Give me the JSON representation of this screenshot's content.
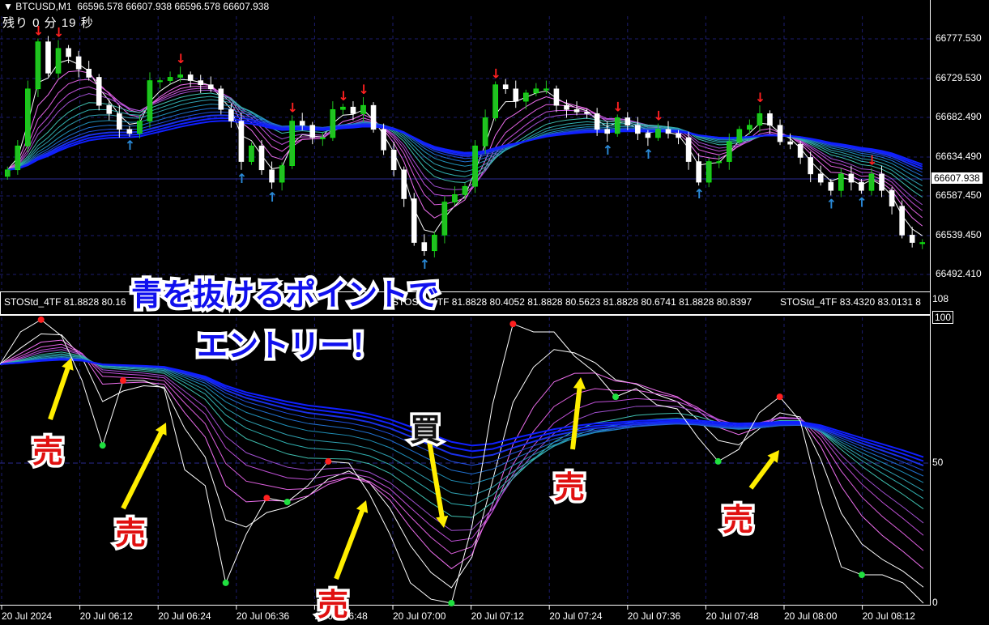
{
  "header": {
    "symbol": "▼ BTCUSD,M1",
    "ohlc": "66596.578 66607.938 66596.578 66607.938",
    "countdown": "残り 0 分 19 秒"
  },
  "indicator_legend": [
    "STOStd_4TF 81.8828 80.16",
    "STOStd_4TF 81.8828 80.4052 81.8828 80.5623 81.8828 80.6741 81.8828 80.8397",
    "STOStd_4TF 83.4320 83.0131 8"
  ],
  "colors": {
    "up": "#22c022",
    "down": "#ffffff",
    "grid": "#1c1c6e",
    "sell": "#ff2020",
    "buy": "#2a8ad8",
    "annotation_text": "#1010ee",
    "annotation_mark": "#e01010",
    "arrow": "#ffee00"
  },
  "chart_data": [
    {
      "type": "candlestick",
      "symbol": "BTCUSD",
      "timeframe": "M1",
      "price_ticks": [
        "66777.530",
        "66729.530",
        "66682.490",
        "66634.490",
        "66587.450",
        "66539.450",
        "66492.410"
      ],
      "current_price": "66607.938",
      "ylim": [
        66470,
        66805
      ],
      "closes": [
        66619,
        66648,
        66717,
        66774,
        66736,
        66766,
        66756,
        66741,
        66731,
        66697,
        66687,
        66668,
        66663,
        66678,
        66727,
        66727,
        66731,
        66734,
        66727,
        66722,
        66717,
        66692,
        66678,
        66629,
        66648,
        66619,
        66604,
        66624,
        66678,
        66673,
        66658,
        66658,
        66692,
        66695,
        66687,
        66697,
        66668,
        66643,
        66619,
        66584,
        66531,
        66521,
        66540,
        66580,
        66589,
        66599,
        66648,
        66682,
        66722,
        66717,
        66702,
        66712,
        66717,
        66717,
        66697,
        66692,
        66689,
        66687,
        66668,
        66663,
        66682,
        66673,
        66663,
        66658,
        66668,
        66663,
        66658,
        66629,
        66604,
        66629,
        66629,
        66653,
        66668,
        66673,
        66687,
        66673,
        66653,
        66650,
        66634,
        66614,
        66604,
        66594,
        66614,
        66604,
        66594,
        66614,
        66594,
        66575,
        66540,
        66531,
        66531
      ]
    },
    {
      "type": "line",
      "name": "STOStd_4TF",
      "y_ticks": [
        "108",
        "100",
        "50",
        "0"
      ],
      "ylim": [
        0,
        100
      ],
      "values": [
        83.6,
        94.9,
        99.2,
        93.5,
        77.9,
        55.2,
        77.9,
        77.9,
        75.1,
        46.7,
        41.1,
        7.1,
        24.1,
        36.8,
        35.4,
        41.1,
        49.6,
        49.0,
        38.2,
        24.1,
        7.1,
        1.4,
        0,
        26.9,
        69.4,
        97.7,
        94.9,
        94.9,
        86.4,
        80.7,
        72.2,
        75.1,
        69.4,
        68.0,
        58.1,
        49.6,
        53.8,
        66.6,
        72.2,
        63.7,
        35.4,
        12.7,
        9.9,
        9.9,
        7.1,
        0
      ]
    },
    {
      "type": "axis",
      "x_ticks": [
        "20 Jul 2024",
        "20 Jul 06:12",
        "20 Jul 06:24",
        "20 Jul 06:36",
        "20 Jul 06:48",
        "20 Jul 07:00",
        "20 Jul 07:12",
        "20 Jul 07:24",
        "20 Jul 07:36",
        "20 Jul 07:48",
        "20 Jul 08:00",
        "20 Jul 08:12"
      ]
    }
  ],
  "annotations": {
    "headline1": "青を抜けるポイントで",
    "headline2": "エントリー！",
    "sell": "売",
    "buy": "買"
  }
}
